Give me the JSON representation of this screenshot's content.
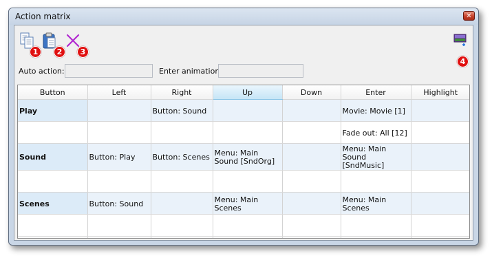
{
  "window": {
    "title": "Action matrix",
    "close_glyph": "✕"
  },
  "toolbar": {
    "items": [
      {
        "icon": "copy-icon",
        "badge": "1"
      },
      {
        "icon": "paste-icon",
        "badge": "2"
      },
      {
        "icon": "delete-x-icon",
        "badge": "3"
      },
      {
        "icon": "screen-preview-icon",
        "badge": "4"
      }
    ]
  },
  "fields": {
    "auto_action": {
      "label": "Auto action:",
      "value": ""
    },
    "enter_animation": {
      "label": "Enter animation:",
      "value": ""
    }
  },
  "grid": {
    "columns": [
      "Button",
      "Left",
      "Right",
      "Up",
      "Down",
      "Enter",
      "Highlight"
    ],
    "active_column": "Up",
    "rows": [
      {
        "cells": [
          "Play",
          "",
          "Button: Sound",
          "",
          "",
          "Movie: Movie [1]",
          ""
        ]
      },
      {
        "cells": [
          "",
          "",
          "",
          "",
          "",
          "Fade out: All [12]",
          ""
        ]
      },
      {
        "cells": [
          "Sound",
          "Button: Play",
          "Button: Scenes",
          "Menu: Main Sound [SndOrg]",
          "",
          "Menu: Main Sound [SndMusic]",
          ""
        ]
      },
      {
        "cells": [
          "",
          "",
          "",
          "",
          "",
          "",
          ""
        ]
      },
      {
        "cells": [
          "Scenes",
          "Button: Sound",
          "",
          "Menu: Main Scenes",
          "",
          "Menu: Main Scenes",
          ""
        ]
      },
      {
        "cells": [
          "",
          "",
          "",
          "",
          "",
          "",
          ""
        ]
      },
      {
        "cells": [
          "",
          "",
          "",
          "",
          "",
          "",
          ""
        ]
      }
    ]
  },
  "colors": {
    "badge": "#e01010",
    "active_header": "#c6e5f6",
    "row_shade": "#eaf2fa"
  }
}
